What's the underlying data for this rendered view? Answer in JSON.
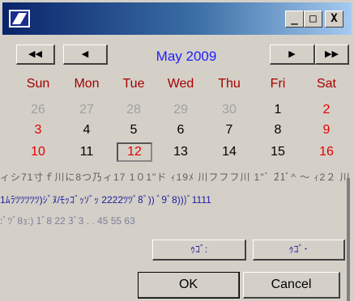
{
  "window": {
    "minimize_label": "_",
    "maximize_label": "□",
    "close_label": "X"
  },
  "nav": {
    "prev_year": "◀◀",
    "prev_month": "◀",
    "next_month": "▶",
    "next_year": "▶▶"
  },
  "month_title": "May 2009",
  "weekdays": [
    "Sun",
    "Mon",
    "Tue",
    "Wed",
    "Thu",
    "Fri",
    "Sat"
  ],
  "weeks": [
    [
      "26",
      "27",
      "28",
      "29",
      "30",
      "1",
      "2"
    ],
    [
      "3",
      "4",
      "5",
      "6",
      "7",
      "8",
      "9"
    ],
    [
      "10",
      "11",
      "12",
      "13",
      "14",
      "15",
      "16"
    ]
  ],
  "garbled": {
    "row1": "ィシ71寸ｆ川に8つ乃ィ17 1０1\"ド ｨ19ﾒ 川フフフ川 1\"ﾞ 2゙1ﾞ^ ～ ｨ2２ 川 〃＝",
    "row2": "1ﾑﾗﾂﾂﾂﾂﾂ)ｼﾞﾇ/ﾓｯｺﾞｯｿﾞｯ 2222ﾂﾂﾞ8ﾞ)) ﾞ9ﾞ8)))ﾞ1111",
    "row3": ":ﾞﾂﾞ8ｮ:) 1ﾞ8     22     3ﾞ3    . . 45      55      63"
  },
  "actions": {
    "today_label": "ｩｺﾞ:",
    "clear_label": "ｩｺﾞ･"
  },
  "buttons": {
    "ok": "OK",
    "cancel": "Cancel"
  },
  "colors": {
    "titlebar_start": "#0a246a",
    "titlebar_end": "#a6caf0",
    "month_title": "#1d1dff",
    "weekday_header": "#a40000",
    "weekend": "#e00000",
    "other_month": "#a0a0a0",
    "face": "#d4d0c8"
  }
}
